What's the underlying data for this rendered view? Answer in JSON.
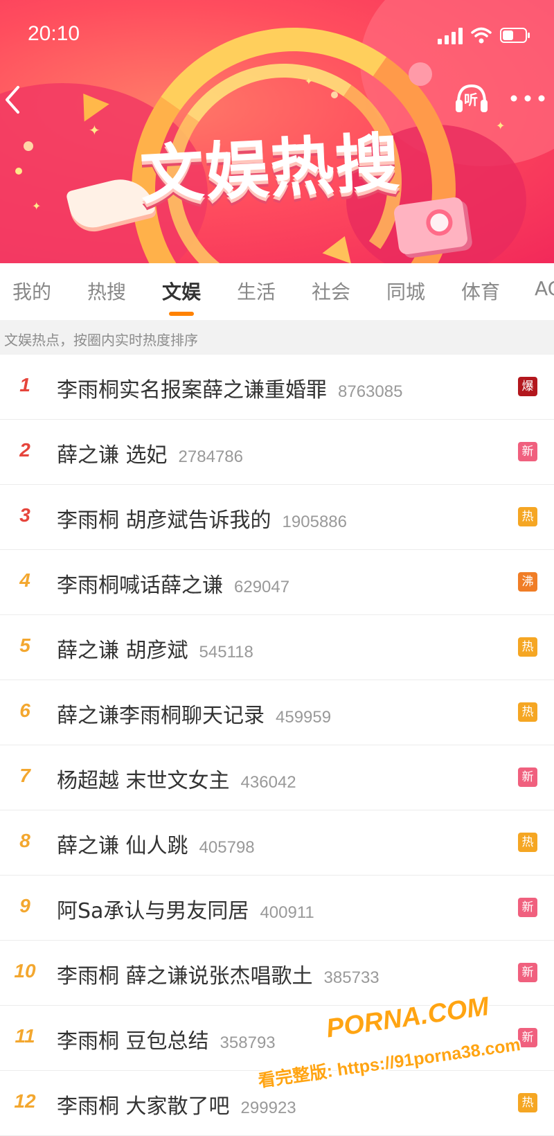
{
  "status_bar": {
    "time": "20:10"
  },
  "banner": {
    "title": "文娱热搜",
    "listen_label": "听"
  },
  "tabs": [
    {
      "label": "我的",
      "active": false
    },
    {
      "label": "热搜",
      "active": false
    },
    {
      "label": "文娱",
      "active": true
    },
    {
      "label": "生活",
      "active": false
    },
    {
      "label": "社会",
      "active": false
    },
    {
      "label": "同城",
      "active": false
    },
    {
      "label": "体育",
      "active": false
    },
    {
      "label": "AC",
      "active": false
    }
  ],
  "subheader": "文娱热点，按圈内实时热度排序",
  "colors": {
    "accent_underline": "#ff8200",
    "rank_top3": "#e6453c",
    "rank_other": "#f3a72f",
    "badge_bao": "#b3171d",
    "badge_xin": "#f0607e",
    "badge_re": "#f5a623",
    "badge_fei": "#f07d26"
  },
  "list": [
    {
      "rank": "1",
      "title": "李雨桐实名报案薛之谦重婚罪",
      "count": "8763085",
      "badge": "爆",
      "badge_type": "bao"
    },
    {
      "rank": "2",
      "title": "薛之谦 选妃",
      "count": "2784786",
      "badge": "新",
      "badge_type": "xin"
    },
    {
      "rank": "3",
      "title": "李雨桐 胡彦斌告诉我的",
      "count": "1905886",
      "badge": "热",
      "badge_type": "re"
    },
    {
      "rank": "4",
      "title": "李雨桐喊话薛之谦",
      "count": "629047",
      "badge": "沸",
      "badge_type": "fei"
    },
    {
      "rank": "5",
      "title": "薛之谦 胡彦斌",
      "count": "545118",
      "badge": "热",
      "badge_type": "re"
    },
    {
      "rank": "6",
      "title": "薛之谦李雨桐聊天记录",
      "count": "459959",
      "badge": "热",
      "badge_type": "re"
    },
    {
      "rank": "7",
      "title": "杨超越 末世文女主",
      "count": "436042",
      "badge": "新",
      "badge_type": "xin"
    },
    {
      "rank": "8",
      "title": "薛之谦 仙人跳",
      "count": "405798",
      "badge": "热",
      "badge_type": "re"
    },
    {
      "rank": "9",
      "title": "阿Sa承认与男友同居",
      "count": "400911",
      "badge": "新",
      "badge_type": "xin"
    },
    {
      "rank": "10",
      "title": "李雨桐 薛之谦说张杰唱歌土",
      "count": "385733",
      "badge": "新",
      "badge_type": "xin"
    },
    {
      "rank": "11",
      "title": "李雨桐 豆包总结",
      "count": "358793",
      "badge": "新",
      "badge_type": "xin"
    },
    {
      "rank": "12",
      "title": "李雨桐 大家散了吧",
      "count": "299923",
      "badge": "热",
      "badge_type": "re"
    }
  ],
  "watermark": {
    "brand": "PORNA.COM",
    "text": "看完整版: https://91porna38.com"
  }
}
